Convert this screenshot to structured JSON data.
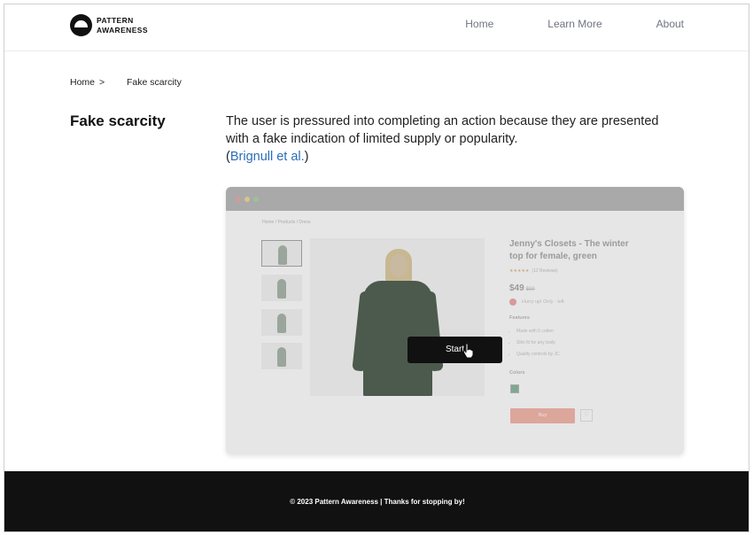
{
  "brand": {
    "line1": "PATTERN",
    "line2": "AWARENESS"
  },
  "nav": {
    "home": "Home",
    "learn_more": "Learn More",
    "about": "About"
  },
  "breadcrumb": {
    "home": "Home",
    "separator": ">",
    "current": "Fake scarcity"
  },
  "content": {
    "title": "Fake scarcity",
    "description": "The user is pressured into completing an action because they are presented with a fake indication of limited supply or popularity.",
    "citation_open": "(",
    "citation_link": "Brignull et al.",
    "citation_close": ")"
  },
  "demo": {
    "breadcrumb": "Home / Products / Dress",
    "product_title": "Jenny's Closets - The winter top for female, green",
    "stars": "★★★★★",
    "reviews": "(12 Reviews)",
    "price": "$49",
    "old_price": "$99",
    "hurry_text": "Hurry up! Only · left",
    "features_heading": "Features",
    "features": [
      "Made with 5 cotton",
      "Slim fit for any body",
      "Quality controls by JC"
    ],
    "colors_heading": "Colors",
    "buy_label": "Buy",
    "heart_icon": "♡",
    "start_label": "Start",
    "colors": {
      "swatch": "#7fa890",
      "buy": "#dca69b"
    }
  },
  "footer": {
    "text": "© 2023 Pattern Awareness | Thanks for stopping by!"
  }
}
